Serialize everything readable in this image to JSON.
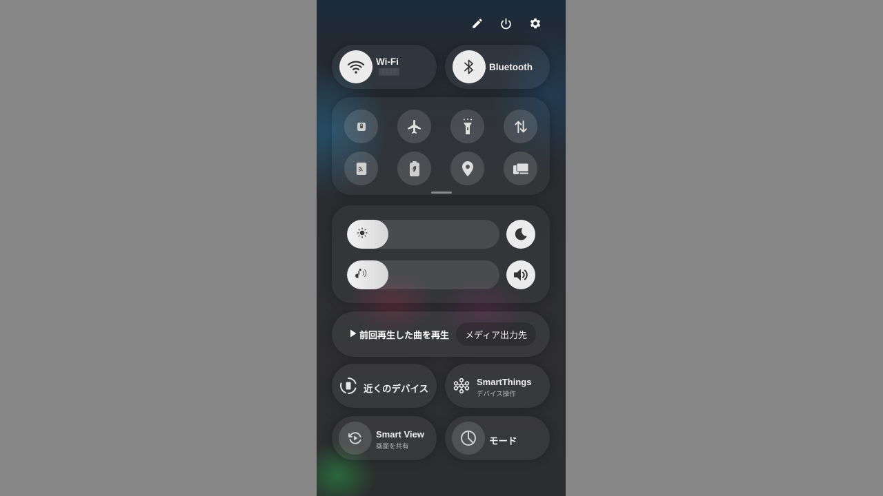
{
  "header": {
    "icons": [
      "edit-icon",
      "power-icon",
      "settings-icon"
    ]
  },
  "connectivity": {
    "wifi": {
      "label": "Wi-Fi",
      "network": "▒▒▒▒▒",
      "active": true
    },
    "bluetooth": {
      "label": "Bluetooth",
      "active": true
    }
  },
  "quick_tiles": [
    {
      "icon": "lock-icon"
    },
    {
      "icon": "airplane-icon"
    },
    {
      "icon": "flashlight-icon"
    },
    {
      "icon": "mobile-data-icon"
    },
    {
      "icon": "nfc-icon"
    },
    {
      "icon": "power-saving-icon"
    },
    {
      "icon": "location-icon"
    },
    {
      "icon": "device-switch-icon"
    }
  ],
  "sliders": {
    "brightness": {
      "icon": "sun-icon",
      "level": 0.27,
      "side_button": "dark-mode-icon"
    },
    "volume": {
      "icon": "music-note-icon",
      "level": 0.27,
      "side_button": "speaker-icon"
    }
  },
  "media": {
    "play_label": "前回再生した曲を再生",
    "output_label": "メディア出力先"
  },
  "shortcuts": {
    "nearby": {
      "label": "近くのデバイス"
    },
    "smartthings": {
      "label": "SmartThings",
      "sub": "デバイス操作"
    },
    "smartview": {
      "label": "Smart View",
      "sub": "画面を共有"
    },
    "mode": {
      "label": "モード"
    }
  }
}
